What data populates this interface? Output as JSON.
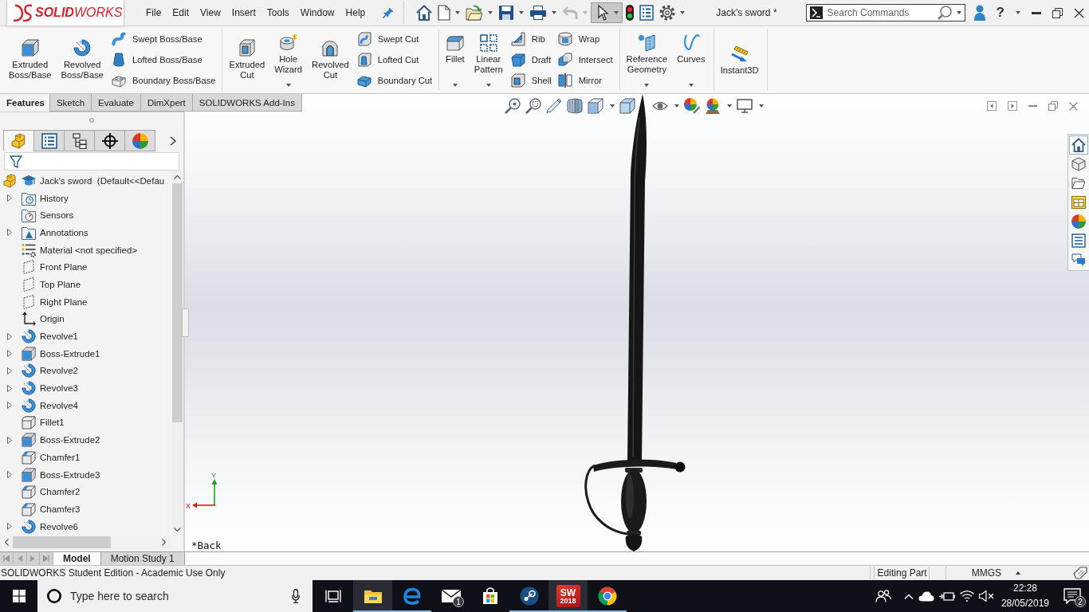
{
  "title_bar": {
    "logo": "**SOLID**WORKS",
    "menu": [
      "File",
      "Edit",
      "View",
      "Insert",
      "Tools",
      "Window",
      "Help"
    ],
    "quick_access": [
      {
        "dropdown": false,
        "disabled": false,
        "selected": false
      },
      {
        "dropdown": true,
        "disabled": false,
        "selected": false
      },
      {
        "dropdown": true,
        "disabled": false,
        "selected": false
      },
      {
        "dropdown": true,
        "disabled": false,
        "selected": false
      },
      {
        "dropdown": true,
        "disabled": false,
        "selected": false
      },
      {
        "dropdown": true,
        "disabled": true,
        "selected": false
      },
      {
        "dropdown": true,
        "disabled": false,
        "selected": true
      },
      {
        "dropdown": false,
        "disabled": false,
        "selected": false
      },
      {
        "dropdown": false,
        "disabled": false,
        "selected": false
      },
      {
        "dropdown": true,
        "disabled": false,
        "selected": false
      }
    ],
    "document_title": "Jack's sword *",
    "search": {
      "placeholder": "Search Commands"
    },
    "help": "?"
  },
  "ribbon": {
    "groups": [
      {
        "large": [
          {
            "label": "Extruded Boss/Base",
            "dropdown": false
          },
          {
            "label": "Revolved Boss/Base",
            "dropdown": false
          }
        ],
        "columns": [
          [
            "Swept Boss/Base",
            "Lofted Boss/Base",
            "Boundary Boss/Base"
          ]
        ]
      },
      {
        "large": [
          {
            "label": "Extruded Cut",
            "dropdown": false
          },
          {
            "label": "Hole Wizard",
            "dropdown": true
          },
          {
            "label": "Revolved Cut",
            "dropdown": false
          }
        ],
        "columns": [
          [
            "Swept Cut",
            "Lofted Cut",
            "Boundary Cut"
          ]
        ]
      },
      {
        "large": [
          {
            "label": "Fillet",
            "dropdown": true
          },
          {
            "label": "Linear Pattern",
            "dropdown": true
          }
        ],
        "columns": [
          [
            "Rib",
            "Draft",
            "Shell"
          ],
          [
            "Wrap",
            "Intersect",
            "Mirror"
          ]
        ]
      },
      {
        "large": [
          {
            "label": "Reference Geometry",
            "dropdown": true
          },
          {
            "label": "Curves",
            "dropdown": true
          }
        ]
      },
      {
        "large": [
          {
            "label": "Instant3D",
            "dropdown": false
          }
        ]
      }
    ]
  },
  "command_tabs": [
    {
      "label": "Features",
      "selected": true
    },
    {
      "label": "Sketch",
      "selected": false
    },
    {
      "label": "Evaluate",
      "selected": false
    },
    {
      "label": "DimXpert",
      "selected": false
    },
    {
      "label": "SOLIDWORKS Add-Ins",
      "selected": false
    }
  ],
  "feature_manager": {
    "tabs": [
      {
        "selected": true
      },
      {
        "selected": false
      },
      {
        "selected": false
      },
      {
        "selected": false
      },
      {
        "selected": false
      }
    ],
    "tree": [
      {
        "label": "Jack's sword  (Default<<Defau",
        "kind": "part",
        "has_children": false
      },
      {
        "label": "History",
        "kind": "history",
        "has_children": true
      },
      {
        "label": "Sensors",
        "kind": "sensors",
        "has_children": false
      },
      {
        "label": "Annotations",
        "kind": "annotations",
        "has_children": true
      },
      {
        "label": "Material <not specified>",
        "kind": "material",
        "has_children": false
      },
      {
        "label": "Front Plane",
        "kind": "plane",
        "has_children": false
      },
      {
        "label": "Top Plane",
        "kind": "plane",
        "has_children": false
      },
      {
        "label": "Right Plane",
        "kind": "plane",
        "has_children": false
      },
      {
        "label": "Origin",
        "kind": "origin",
        "has_children": false
      },
      {
        "label": "Revolve1",
        "kind": "revolve",
        "has_children": true
      },
      {
        "label": "Boss-Extrude1",
        "kind": "extrude",
        "has_children": true
      },
      {
        "label": "Revolve2",
        "kind": "revolve",
        "has_children": true
      },
      {
        "label": "Revolve3",
        "kind": "revolve",
        "has_children": true
      },
      {
        "label": "Revolve4",
        "kind": "revolve",
        "has_children": true
      },
      {
        "label": "Fillet1",
        "kind": "fillet",
        "has_children": false
      },
      {
        "label": "Boss-Extrude2",
        "kind": "extrude",
        "has_children": true
      },
      {
        "label": "Chamfer1",
        "kind": "chamfer",
        "has_children": false
      },
      {
        "label": "Boss-Extrude3",
        "kind": "extrude",
        "has_children": true
      },
      {
        "label": "Chamfer2",
        "kind": "chamfer",
        "has_children": false
      },
      {
        "label": "Chamfer3",
        "kind": "chamfer",
        "has_children": false
      },
      {
        "label": "Revolve6",
        "kind": "revolve",
        "has_children": true
      }
    ]
  },
  "viewport": {
    "view_toolbar": [
      {
        "dropdown": false
      },
      {
        "dropdown": false
      },
      {
        "dropdown": false
      },
      {
        "dropdown": false
      },
      {
        "dropdown": true
      },
      {
        "dropdown": false
      },
      {
        "dropdown": true
      },
      {
        "dropdown": false
      },
      {
        "dropdown": true
      },
      {
        "dropdown": true
      }
    ],
    "triad": {
      "x": "X",
      "y": "Y"
    },
    "view_label": "*Back"
  },
  "bottom_tabs": [
    {
      "label": "Model",
      "selected": true
    },
    {
      "label": "Motion Study 1",
      "selected": false
    }
  ],
  "status_bar": {
    "message": "SOLIDWORKS Student Edition - Academic Use Only",
    "mode": "Editing Part",
    "units": "MMGS"
  },
  "taskbar": {
    "search": {
      "placeholder": "Type here to search"
    },
    "apps": [
      {
        "running": true,
        "active": true
      },
      {
        "running": true,
        "active": false
      },
      {
        "running": false,
        "active": false,
        "badge": "1"
      },
      {
        "running": false,
        "active": false
      },
      {
        "running": true,
        "active": false
      },
      {
        "running": true,
        "active": true,
        "logo": "SW",
        "caption": "2018"
      },
      {
        "running": true,
        "active": false
      }
    ],
    "tray": {
      "muted": true,
      "time": "22:28",
      "date": "28/05/2019",
      "notifications": "2"
    }
  }
}
